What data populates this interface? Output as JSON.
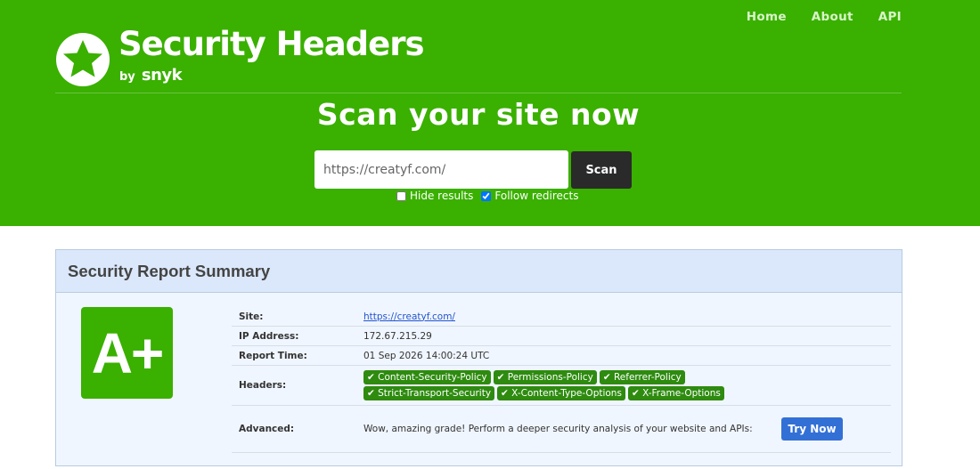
{
  "nav": {
    "items": [
      "Home",
      "About",
      "API"
    ]
  },
  "brand": {
    "title": "Security Headers",
    "by": "by",
    "company": "snyk"
  },
  "hero": {
    "headline": "Scan your site now",
    "search_value": "https://creatyf.com/",
    "scan_label": "Scan",
    "options": [
      {
        "label": "Hide results",
        "checked": false
      },
      {
        "label": "Follow redirects",
        "checked": true
      }
    ]
  },
  "report": {
    "title": "Security Report Summary",
    "grade": "A+",
    "grade_color": "#3ab000",
    "rows": {
      "site_label": "Site:",
      "site_value": "https://creatyf.com/",
      "ip_label": "IP Address:",
      "ip_value": "172.67.215.29",
      "time_label": "Report Time:",
      "time_value": "01 Sep 2026 14:00:24 UTC",
      "headers_label": "Headers:",
      "headers": [
        "✔ Content-Security-Policy",
        "✔ Permissions-Policy",
        "✔ Referrer-Policy",
        "✔ Strict-Transport-Security",
        "✔ X-Content-Type-Options",
        "✔ X-Frame-Options"
      ],
      "advanced_label": "Advanced:",
      "advanced_text": "Wow, amazing grade! Perform a deeper security analysis of your website and APIs:",
      "try_label": "Try Now"
    }
  },
  "colors": {
    "brand_green": "#3ab000",
    "badge_green": "#2e8b10",
    "button_blue": "#3370d6"
  }
}
